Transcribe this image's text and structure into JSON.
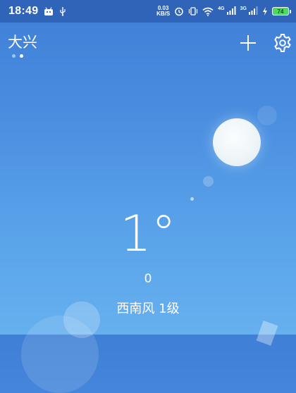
{
  "status_bar": {
    "time": "18:49",
    "net_speed_value": "0.03",
    "net_speed_unit": "KB/S",
    "signal1_gen": "4G",
    "signal2_gen": "3G",
    "battery_level": "74"
  },
  "header": {
    "city": "大兴",
    "page_count": 2,
    "active_page": 2
  },
  "weather": {
    "temperature": "1°",
    "aqi": "0",
    "wind": "西南风 1级"
  },
  "icons": {
    "add": "plus-icon",
    "settings": "gear-icon",
    "sun": "sun-icon"
  },
  "colors": {
    "status_bar": "#2f64b8",
    "sky_top": "#3f7fd6",
    "sky_bottom": "#66b0ef",
    "battery": "#4cd964"
  }
}
